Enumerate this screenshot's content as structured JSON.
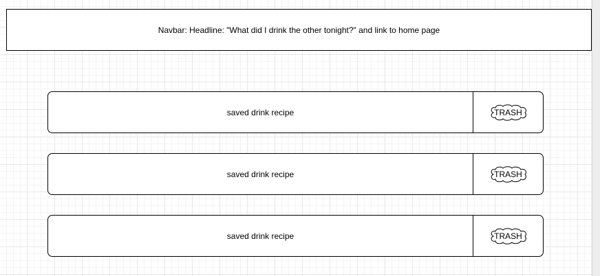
{
  "navbar": {
    "text": "Navbar: Headline: \"What did I drink the other tonight?\" and link to home page"
  },
  "recipes": [
    {
      "label": "saved drink recipe",
      "trash_label": "TRASH"
    },
    {
      "label": "saved drink recipe",
      "trash_label": "TRASH"
    },
    {
      "label": "saved drink recipe",
      "trash_label": "TRASH"
    }
  ],
  "icons": {
    "trash": "cloud-shape"
  },
  "colors": {
    "stroke": "#000000",
    "fill": "#ffffff",
    "grid": "#e7e7e7"
  }
}
